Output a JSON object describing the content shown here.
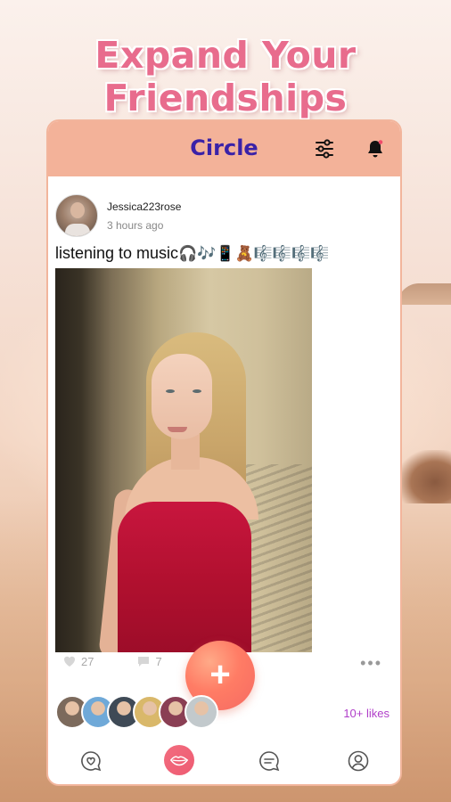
{
  "headline": "Expand Your Friendships",
  "header": {
    "title": "Circle",
    "filter_icon": "sliders-icon",
    "notification_icon": "bell-icon",
    "accent_color": "#3a22a8",
    "header_bg": "#f3b299"
  },
  "post": {
    "author": "Jessica223rose",
    "time": "3 hours ago",
    "text": "listening to music",
    "emojis": "🎧🎶📱🧸",
    "faded_emojis": "🎼🎼🎼🎼",
    "likes": "27",
    "comments": "7",
    "more_icon": "more-dots-icon",
    "dots": "•••"
  },
  "fab": {
    "label": "+",
    "icon": "plus-icon"
  },
  "likers": {
    "count_label": "10+ likes",
    "avatars": [
      {
        "bg": "#7c6a5c"
      },
      {
        "bg": "#6fa9d8"
      },
      {
        "bg": "#3f4a56"
      },
      {
        "bg": "#d9b86a"
      },
      {
        "bg": "#8a3f54"
      },
      {
        "bg": "#c2c9cc"
      }
    ]
  },
  "nav": {
    "items": [
      {
        "name": "moments",
        "icon": "chat-heart-icon"
      },
      {
        "name": "circle",
        "icon": "lips-icon"
      },
      {
        "name": "messages",
        "icon": "messages-icon"
      },
      {
        "name": "profile",
        "icon": "profile-icon"
      }
    ]
  }
}
